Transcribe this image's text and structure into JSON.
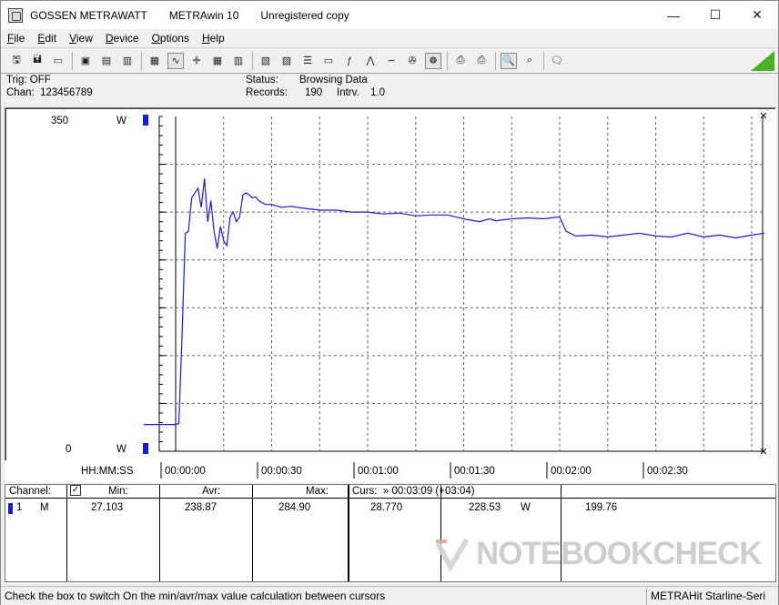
{
  "window": {
    "brand": "GOSSEN METRAWATT",
    "app": "METRAwin 10",
    "license": "Unregistered copy",
    "minimize_glyph": "—",
    "maximize_glyph": "☐",
    "close_glyph": "✕"
  },
  "menu": [
    {
      "u": "F",
      "rest": "ile"
    },
    {
      "u": "E",
      "rest": "dit"
    },
    {
      "u": "V",
      "rest": "iew"
    },
    {
      "u": "D",
      "rest": "evice"
    },
    {
      "u": "O",
      "rest": "ptions"
    },
    {
      "u": "H",
      "rest": "elp"
    }
  ],
  "toolbar": {
    "accent": "#4caf2a",
    "icons": [
      "open-icon",
      "save-icon",
      "folder-icon",
      "device-icon",
      "device-config-icon",
      "device-read-icon",
      "grid-toggle-icon",
      "waveform-icon",
      "crosshair-icon",
      "table-view-icon",
      "bar-view-icon",
      "zoom-icon",
      "print-preview-icon",
      "print-list-icon",
      "screen-icon",
      "function-icon",
      "pulse-icon",
      "sine-icon",
      "compass-icon",
      "recorder-icon",
      "printer-icon",
      "printer-setup-icon",
      "zoom-wave-icon",
      "zoom-wave-out-icon",
      "comment-icon"
    ]
  },
  "info": {
    "trig": "Trig: OFF",
    "chan": "Chan:  123456789",
    "status_label": "Status:",
    "status_value": "Browsing Data",
    "records_label": "Records:",
    "records_value": "190",
    "intrv_label": "Intrv.",
    "intrv_value": "1.0"
  },
  "plot": {
    "y_top": "350",
    "y_bottom": "0",
    "unit": "W",
    "line_color": "#1a1adf",
    "time_axis_label": "HH:MM:SS",
    "time_ticks": [
      "00:00:00",
      "00:00:30",
      "00:01:00",
      "00:01:30",
      "00:02:00",
      "00:02:30"
    ]
  },
  "chart_data": {
    "type": "line",
    "ylim": [
      0,
      350
    ],
    "ylabel": "W",
    "xlabel": "HH:MM:SS",
    "x_unit": "seconds",
    "series": [
      {
        "x": [
          -10,
          0,
          1,
          2,
          3,
          4,
          5,
          6,
          7,
          8,
          9,
          10,
          11,
          12,
          13,
          14,
          15,
          16,
          17,
          18,
          19,
          20,
          21,
          22,
          23,
          24,
          25,
          26,
          27,
          28,
          30,
          33,
          36,
          40,
          45,
          50,
          55,
          60,
          65,
          70,
          75,
          80,
          85,
          90,
          95,
          98,
          100,
          105,
          110,
          115,
          120,
          122,
          125,
          130,
          135,
          140,
          145,
          150,
          155,
          160,
          165,
          170,
          175,
          180,
          184
        ],
        "y": [
          28,
          28,
          29,
          120,
          228,
          230,
          265,
          270,
          275,
          255,
          285,
          240,
          262,
          230,
          212,
          235,
          220,
          215,
          245,
          250,
          240,
          245,
          268,
          270,
          268,
          265,
          266,
          262,
          260,
          258,
          258,
          255,
          256,
          254,
          252,
          252,
          250,
          250,
          248,
          249,
          246,
          247,
          247,
          243,
          240,
          243,
          241,
          243,
          244,
          243,
          245,
          230,
          225,
          226,
          224,
          226,
          228,
          225,
          224,
          228,
          224,
          226,
          223,
          226,
          228
        ]
      }
    ]
  },
  "table": {
    "headers": {
      "channel": "Channel:",
      "check": "✓",
      "min": "Min:",
      "avr": "Avr:",
      "max": "Max:",
      "curs": "Curs:  » 00:03:09 (+03:04)"
    },
    "row": {
      "num": "1",
      "letter": "M",
      "min": "27.103",
      "avr": "238.87",
      "max": "284.90",
      "c1": "28.770",
      "c2": "228.53",
      "c2_unit": "W",
      "c3": "199.76"
    }
  },
  "status": {
    "hint": "Check the box to switch On the min/avr/max value calculation between cursors",
    "device": "METRAHit Starline-Seri"
  },
  "watermark": "NOTEBOOKCHECK"
}
